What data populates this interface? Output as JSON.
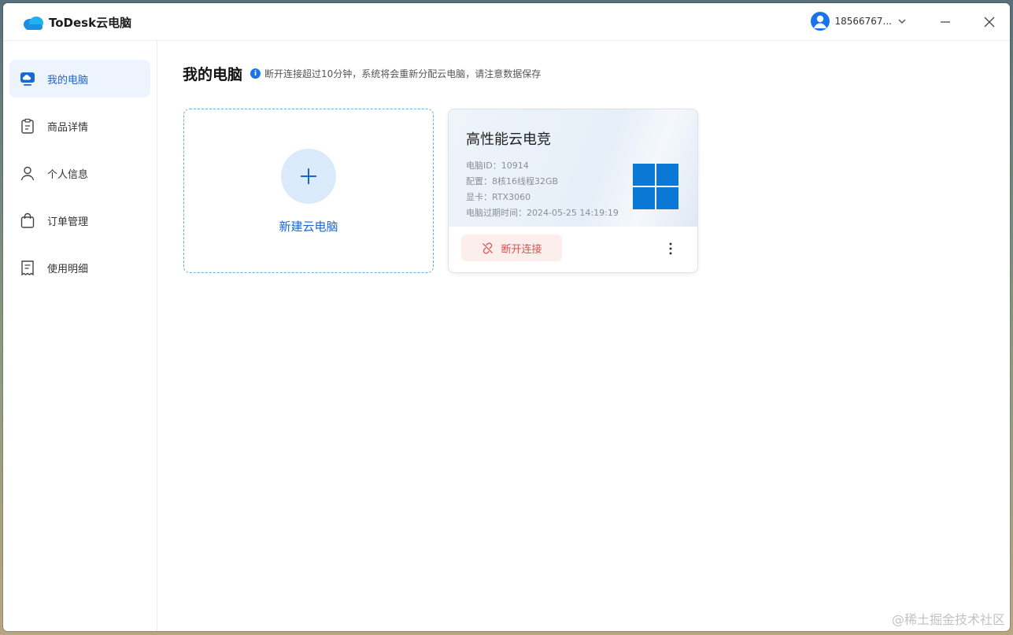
{
  "app": {
    "title": "ToDesk云电脑"
  },
  "header": {
    "user_name": "18566767..."
  },
  "sidebar": {
    "items": [
      {
        "label": "我的电脑",
        "icon": "cloud-monitor-icon",
        "active": true
      },
      {
        "label": "商品详情",
        "icon": "clipboard-icon",
        "active": false
      },
      {
        "label": "个人信息",
        "icon": "user-icon",
        "active": false
      },
      {
        "label": "订单管理",
        "icon": "shopping-bag-icon",
        "active": false
      },
      {
        "label": "使用明细",
        "icon": "receipt-icon",
        "active": false
      }
    ]
  },
  "main": {
    "title": "我的电脑",
    "notice": "断开连接超过10分钟，系统将会重新分配云电脑，请注意数据保存",
    "new_card": {
      "label": "新建云电脑"
    },
    "pc_card": {
      "name": "高性能云电竞",
      "specs": [
        "电脑ID：10914",
        "配置：8核16线程32GB",
        "显卡：RTX3060",
        "电脑过期时间：2024-05-25 14:19:19"
      ],
      "disconnect_label": "断开连接"
    }
  },
  "watermark": "@稀土掘金技术社区",
  "colors": {
    "accent": "#1a66d2",
    "danger": "#d9534f",
    "windows_blue": "#0a78d4"
  }
}
